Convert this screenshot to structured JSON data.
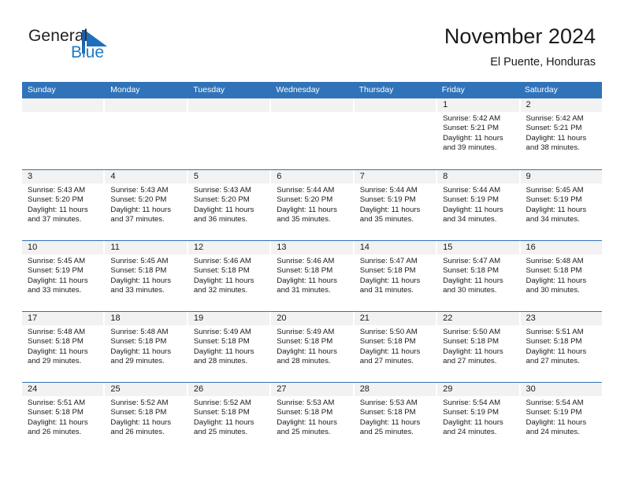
{
  "brand": {
    "name_part1": "General",
    "name_part2": "Blue",
    "mark_icon": "blue-triangle-flag-icon"
  },
  "header": {
    "title": "November 2024",
    "subtitle": "El Puente, Honduras"
  },
  "colors": {
    "header_blue": "#3173b8",
    "brand_blue": "#1f7ac4",
    "day_number_strip": "#f2f2f2",
    "text": "#1a1a1a"
  },
  "weekdays": [
    "Sunday",
    "Monday",
    "Tuesday",
    "Wednesday",
    "Thursday",
    "Friday",
    "Saturday"
  ],
  "weeks": [
    [
      {
        "day": "",
        "sunrise": "",
        "sunset": "",
        "daylight1": "",
        "daylight2": "",
        "empty": true
      },
      {
        "day": "",
        "sunrise": "",
        "sunset": "",
        "daylight1": "",
        "daylight2": "",
        "empty": true
      },
      {
        "day": "",
        "sunrise": "",
        "sunset": "",
        "daylight1": "",
        "daylight2": "",
        "empty": true
      },
      {
        "day": "",
        "sunrise": "",
        "sunset": "",
        "daylight1": "",
        "daylight2": "",
        "empty": true
      },
      {
        "day": "",
        "sunrise": "",
        "sunset": "",
        "daylight1": "",
        "daylight2": "",
        "empty": true
      },
      {
        "day": "1",
        "sunrise": "Sunrise: 5:42 AM",
        "sunset": "Sunset: 5:21 PM",
        "daylight1": "Daylight: 11 hours",
        "daylight2": "and 39 minutes."
      },
      {
        "day": "2",
        "sunrise": "Sunrise: 5:42 AM",
        "sunset": "Sunset: 5:21 PM",
        "daylight1": "Daylight: 11 hours",
        "daylight2": "and 38 minutes."
      }
    ],
    [
      {
        "day": "3",
        "sunrise": "Sunrise: 5:43 AM",
        "sunset": "Sunset: 5:20 PM",
        "daylight1": "Daylight: 11 hours",
        "daylight2": "and 37 minutes."
      },
      {
        "day": "4",
        "sunrise": "Sunrise: 5:43 AM",
        "sunset": "Sunset: 5:20 PM",
        "daylight1": "Daylight: 11 hours",
        "daylight2": "and 37 minutes."
      },
      {
        "day": "5",
        "sunrise": "Sunrise: 5:43 AM",
        "sunset": "Sunset: 5:20 PM",
        "daylight1": "Daylight: 11 hours",
        "daylight2": "and 36 minutes."
      },
      {
        "day": "6",
        "sunrise": "Sunrise: 5:44 AM",
        "sunset": "Sunset: 5:20 PM",
        "daylight1": "Daylight: 11 hours",
        "daylight2": "and 35 minutes."
      },
      {
        "day": "7",
        "sunrise": "Sunrise: 5:44 AM",
        "sunset": "Sunset: 5:19 PM",
        "daylight1": "Daylight: 11 hours",
        "daylight2": "and 35 minutes."
      },
      {
        "day": "8",
        "sunrise": "Sunrise: 5:44 AM",
        "sunset": "Sunset: 5:19 PM",
        "daylight1": "Daylight: 11 hours",
        "daylight2": "and 34 minutes."
      },
      {
        "day": "9",
        "sunrise": "Sunrise: 5:45 AM",
        "sunset": "Sunset: 5:19 PM",
        "daylight1": "Daylight: 11 hours",
        "daylight2": "and 34 minutes."
      }
    ],
    [
      {
        "day": "10",
        "sunrise": "Sunrise: 5:45 AM",
        "sunset": "Sunset: 5:19 PM",
        "daylight1": "Daylight: 11 hours",
        "daylight2": "and 33 minutes."
      },
      {
        "day": "11",
        "sunrise": "Sunrise: 5:45 AM",
        "sunset": "Sunset: 5:18 PM",
        "daylight1": "Daylight: 11 hours",
        "daylight2": "and 33 minutes."
      },
      {
        "day": "12",
        "sunrise": "Sunrise: 5:46 AM",
        "sunset": "Sunset: 5:18 PM",
        "daylight1": "Daylight: 11 hours",
        "daylight2": "and 32 minutes."
      },
      {
        "day": "13",
        "sunrise": "Sunrise: 5:46 AM",
        "sunset": "Sunset: 5:18 PM",
        "daylight1": "Daylight: 11 hours",
        "daylight2": "and 31 minutes."
      },
      {
        "day": "14",
        "sunrise": "Sunrise: 5:47 AM",
        "sunset": "Sunset: 5:18 PM",
        "daylight1": "Daylight: 11 hours",
        "daylight2": "and 31 minutes."
      },
      {
        "day": "15",
        "sunrise": "Sunrise: 5:47 AM",
        "sunset": "Sunset: 5:18 PM",
        "daylight1": "Daylight: 11 hours",
        "daylight2": "and 30 minutes."
      },
      {
        "day": "16",
        "sunrise": "Sunrise: 5:48 AM",
        "sunset": "Sunset: 5:18 PM",
        "daylight1": "Daylight: 11 hours",
        "daylight2": "and 30 minutes."
      }
    ],
    [
      {
        "day": "17",
        "sunrise": "Sunrise: 5:48 AM",
        "sunset": "Sunset: 5:18 PM",
        "daylight1": "Daylight: 11 hours",
        "daylight2": "and 29 minutes."
      },
      {
        "day": "18",
        "sunrise": "Sunrise: 5:48 AM",
        "sunset": "Sunset: 5:18 PM",
        "daylight1": "Daylight: 11 hours",
        "daylight2": "and 29 minutes."
      },
      {
        "day": "19",
        "sunrise": "Sunrise: 5:49 AM",
        "sunset": "Sunset: 5:18 PM",
        "daylight1": "Daylight: 11 hours",
        "daylight2": "and 28 minutes."
      },
      {
        "day": "20",
        "sunrise": "Sunrise: 5:49 AM",
        "sunset": "Sunset: 5:18 PM",
        "daylight1": "Daylight: 11 hours",
        "daylight2": "and 28 minutes."
      },
      {
        "day": "21",
        "sunrise": "Sunrise: 5:50 AM",
        "sunset": "Sunset: 5:18 PM",
        "daylight1": "Daylight: 11 hours",
        "daylight2": "and 27 minutes."
      },
      {
        "day": "22",
        "sunrise": "Sunrise: 5:50 AM",
        "sunset": "Sunset: 5:18 PM",
        "daylight1": "Daylight: 11 hours",
        "daylight2": "and 27 minutes."
      },
      {
        "day": "23",
        "sunrise": "Sunrise: 5:51 AM",
        "sunset": "Sunset: 5:18 PM",
        "daylight1": "Daylight: 11 hours",
        "daylight2": "and 27 minutes."
      }
    ],
    [
      {
        "day": "24",
        "sunrise": "Sunrise: 5:51 AM",
        "sunset": "Sunset: 5:18 PM",
        "daylight1": "Daylight: 11 hours",
        "daylight2": "and 26 minutes."
      },
      {
        "day": "25",
        "sunrise": "Sunrise: 5:52 AM",
        "sunset": "Sunset: 5:18 PM",
        "daylight1": "Daylight: 11 hours",
        "daylight2": "and 26 minutes."
      },
      {
        "day": "26",
        "sunrise": "Sunrise: 5:52 AM",
        "sunset": "Sunset: 5:18 PM",
        "daylight1": "Daylight: 11 hours",
        "daylight2": "and 25 minutes."
      },
      {
        "day": "27",
        "sunrise": "Sunrise: 5:53 AM",
        "sunset": "Sunset: 5:18 PM",
        "daylight1": "Daylight: 11 hours",
        "daylight2": "and 25 minutes."
      },
      {
        "day": "28",
        "sunrise": "Sunrise: 5:53 AM",
        "sunset": "Sunset: 5:18 PM",
        "daylight1": "Daylight: 11 hours",
        "daylight2": "and 25 minutes."
      },
      {
        "day": "29",
        "sunrise": "Sunrise: 5:54 AM",
        "sunset": "Sunset: 5:19 PM",
        "daylight1": "Daylight: 11 hours",
        "daylight2": "and 24 minutes."
      },
      {
        "day": "30",
        "sunrise": "Sunrise: 5:54 AM",
        "sunset": "Sunset: 5:19 PM",
        "daylight1": "Daylight: 11 hours",
        "daylight2": "and 24 minutes."
      }
    ]
  ]
}
